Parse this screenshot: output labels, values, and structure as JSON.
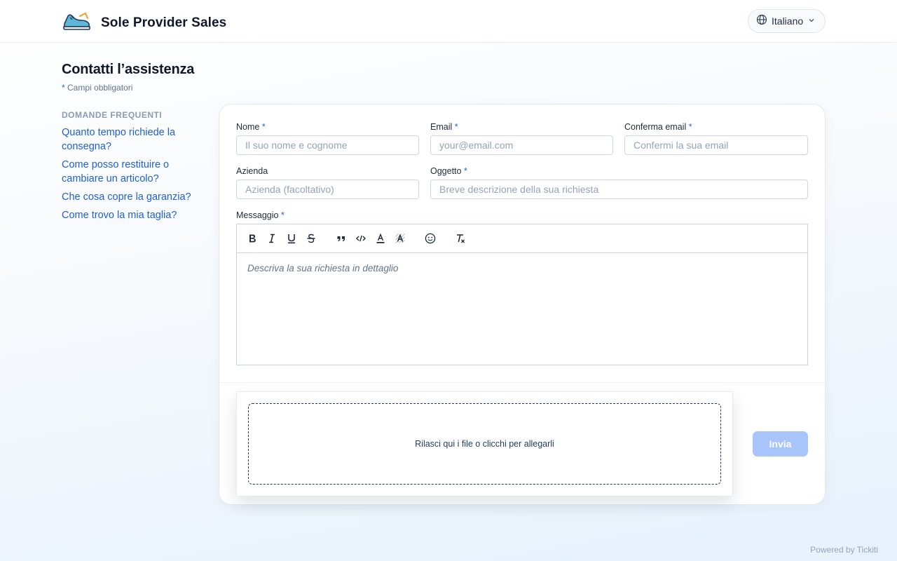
{
  "header": {
    "brand_name": "Sole Provider Sales",
    "brand_icon": "sneaker-logo",
    "language": "Italiano"
  },
  "page": {
    "title": "Contatti l’assistenza",
    "required_note": "Campi obbligatori",
    "required_marker": "*"
  },
  "faq": {
    "title": "DOMANDE FREQUENTI",
    "items": [
      "Quanto tempo richiede la consegna?",
      "Come posso restituire o cambiare un articolo?",
      "Che cosa copre la garanzia?",
      "Come trovo la mia taglia?"
    ]
  },
  "form": {
    "name_label": "Nome",
    "name_placeholder": "Il suo nome e cognome",
    "email_label": "Email",
    "email_placeholder": "your@email.com",
    "confirm_email_label": "Conferma email",
    "confirm_email_placeholder": "Confermi la sua email",
    "company_label": "Azienda",
    "company_placeholder": "Azienda (facoltativo)",
    "subject_label": "Oggetto",
    "subject_placeholder": "Breve descrizione della sua richiesta",
    "message_label": "Messaggio",
    "message_placeholder": "Descriva la sua richiesta in dettaglio",
    "toolbar_icons": [
      "bold-icon",
      "italic-icon",
      "underline-icon",
      "strikethrough-icon",
      "quote-icon",
      "code-icon",
      "text-color-icon",
      "highlight-icon",
      "emoji-icon",
      "clear-format-icon"
    ],
    "dropzone_text": "Rilasci qui i file o clicchi per allegarli",
    "submit_label": "Invia"
  },
  "footer": {
    "powered_by": "Powered by Tickiti"
  },
  "colors": {
    "accent": "#2563eb",
    "link": "#1d5fd6",
    "submit_disabled": "#a9c4fb"
  }
}
